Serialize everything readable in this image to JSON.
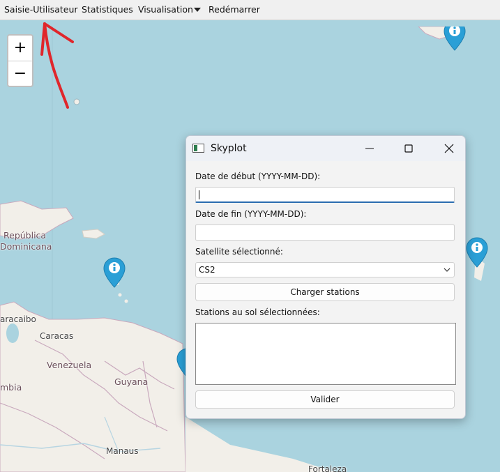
{
  "menubar": {
    "items": [
      "Saisie-Utilisateur",
      "Statistiques",
      "Visualisation",
      "Redémarrer"
    ]
  },
  "map": {
    "zoom_in": "+",
    "zoom_out": "−",
    "labels": [
      "República",
      "Dominicana",
      "aracaibo",
      "Caracas",
      "Venezuela",
      "Guyana",
      "mbia",
      "Manaus",
      "Fortaleza"
    ],
    "colors": {
      "sea": "#aad3df",
      "land": "#f2efe9",
      "border": "#c9a9bd",
      "marker": "#2a9fd6"
    }
  },
  "dialog": {
    "title": "Skyplot",
    "start_date_label": "Date de début (YYYY-MM-DD):",
    "start_date_value": "",
    "end_date_label": "Date de fin (YYYY-MM-DD):",
    "end_date_value": "",
    "satellite_label": "Satellite sélectionné:",
    "satellite_value": "CS2",
    "load_button": "Charger stations",
    "stations_label": "Stations au sol sélectionnées:",
    "validate_button": "Valider"
  },
  "annotation": {
    "color": "#e0262b"
  }
}
